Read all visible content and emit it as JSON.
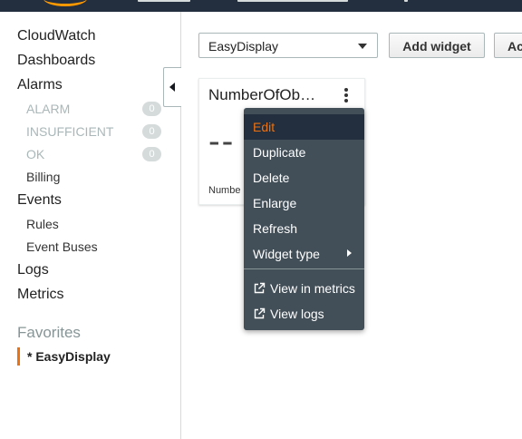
{
  "sidebar": {
    "items": {
      "cloudwatch": "CloudWatch",
      "dashboards": "Dashboards",
      "alarms": "Alarms",
      "alarm_states": [
        {
          "label": "ALARM",
          "count": "0"
        },
        {
          "label": "INSUFFICIENT",
          "count": "0"
        },
        {
          "label": "OK",
          "count": "0"
        }
      ],
      "billing": "Billing",
      "events": "Events",
      "rules": "Rules",
      "event_buses": "Event Buses",
      "logs": "Logs",
      "metrics": "Metrics"
    },
    "favorites": {
      "heading": "Favorites",
      "items": [
        {
          "prefix": "*",
          "label": "EasyDisplay"
        }
      ]
    }
  },
  "toolbar": {
    "dashboard_select": {
      "value": "EasyDisplay"
    },
    "add_widget_label": "Add widget",
    "partial_button_label": "Ac"
  },
  "widget": {
    "title": "NumberOfOb…",
    "value": "--",
    "label": "Numbe"
  },
  "context_menu": {
    "items": [
      {
        "label": "Edit",
        "active": true
      },
      {
        "label": "Duplicate"
      },
      {
        "label": "Delete"
      },
      {
        "label": "Enlarge"
      },
      {
        "label": "Refresh"
      },
      {
        "label": "Widget type",
        "has_submenu": true
      }
    ],
    "external_items": [
      {
        "label": "View in metrics",
        "icon": "external-link-icon"
      },
      {
        "label": "View logs",
        "icon": "external-link-icon"
      }
    ]
  },
  "colors": {
    "topbar": "#232f3e",
    "accent": "#ec7211",
    "menu_bg": "#424f58",
    "badge": "#d5dbdb"
  }
}
